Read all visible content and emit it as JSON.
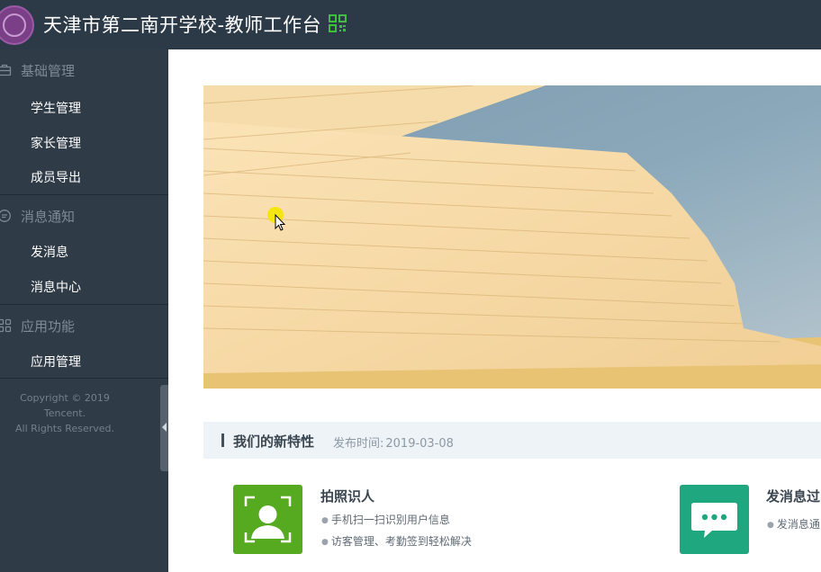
{
  "header": {
    "title": "天津市第二南开学校-教师工作台",
    "icons": [
      "school-logo",
      "qr-code-icon"
    ]
  },
  "sidebar": {
    "sections": [
      {
        "label": "基础管理",
        "icon": "briefcase-icon",
        "items": [
          "学生管理",
          "家长管理",
          "成员导出"
        ]
      },
      {
        "label": "消息通知",
        "icon": "chat-icon",
        "items": [
          "发消息",
          "消息中心"
        ]
      },
      {
        "label": "应用功能",
        "icon": "grid-icon",
        "items": [
          "应用管理"
        ]
      }
    ],
    "copyright_line1": "Copyright © 2019 Tencent.",
    "copyright_line2": "All Rights Reserved."
  },
  "main": {
    "feature_section": {
      "title": "我们的新特性",
      "date_label": "发布时间:",
      "date_value": "2019-03-08"
    },
    "features": [
      {
        "title": "拍照识人",
        "icon": "face-scan-icon",
        "color": "#55aa1f",
        "lines": [
          "手机扫一扫识别用户信息",
          "访客管理、考勤签到轻松解决"
        ]
      },
      {
        "title": "发消息过",
        "icon": "message-bubble-icon",
        "color": "#1fa880",
        "lines": [
          "发消息通"
        ]
      }
    ]
  },
  "colors": {
    "header_bg": "#2c3a47",
    "sidebar_bg": "#2f3b46",
    "sidebar_muted": "#7e8a95",
    "feature_green": "#55aa1f",
    "feature_teal": "#1fa880"
  }
}
